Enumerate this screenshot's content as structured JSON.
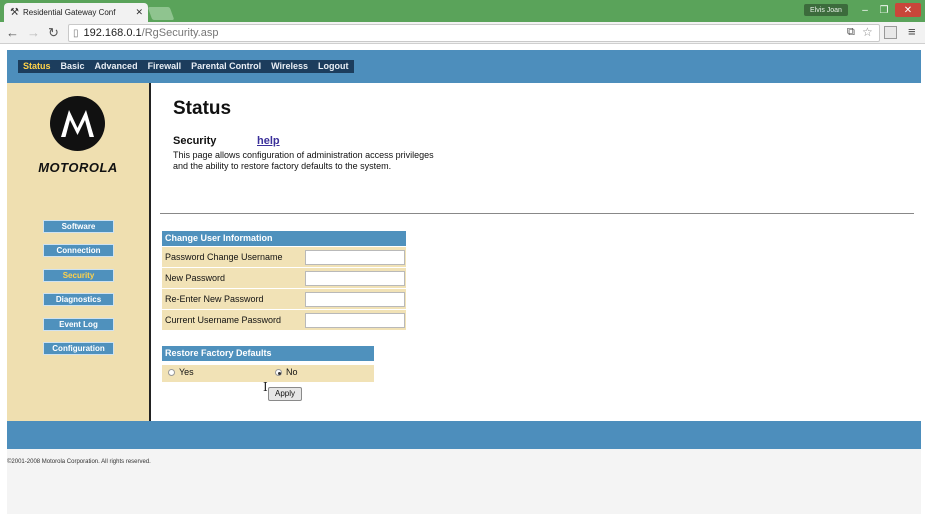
{
  "browser": {
    "tab_title": "Residential Gateway Conf",
    "user_badge": "Elvis Joan",
    "url_host": "192.168.0.1",
    "url_path": "/RgSecurity.asp",
    "icons": [
      "back-icon",
      "forward-icon",
      "reload-icon",
      "page-icon",
      "translate-icon",
      "star-icon",
      "extension-icon",
      "menu-icon",
      "close-icon"
    ]
  },
  "top_nav": {
    "items": [
      {
        "label": "Status",
        "active": true
      },
      {
        "label": "Basic",
        "active": false
      },
      {
        "label": "Advanced",
        "active": false
      },
      {
        "label": "Firewall",
        "active": false
      },
      {
        "label": "Parental Control",
        "active": false
      },
      {
        "label": "Wireless",
        "active": false
      },
      {
        "label": "Logout",
        "active": false
      }
    ]
  },
  "brand": {
    "name": "MOTOROLA"
  },
  "sidebar": {
    "items": [
      {
        "label": "Software",
        "active": false
      },
      {
        "label": "Connection",
        "active": false
      },
      {
        "label": "Security",
        "active": true
      },
      {
        "label": "Diagnostics",
        "active": false
      },
      {
        "label": "Event Log",
        "active": false
      },
      {
        "label": "Configuration",
        "active": false
      }
    ]
  },
  "main": {
    "title": "Status",
    "section": "Security",
    "help": "help",
    "description_line1": "This page allows configuration of administration access privileges",
    "description_line2": "and the ability to restore factory defaults to the system."
  },
  "user_info": {
    "heading": "Change User Information",
    "fields": [
      {
        "label": "Password Change Username",
        "value": ""
      },
      {
        "label": "New Password",
        "value": ""
      },
      {
        "label": "Re-Enter New Password",
        "value": ""
      },
      {
        "label": "Current Username Password",
        "value": ""
      }
    ]
  },
  "restore": {
    "heading": "Restore Factory Defaults",
    "yes_label": "Yes",
    "no_label": "No",
    "selected": "No"
  },
  "apply_label": "Apply",
  "footer": {
    "copyright": "©2001-2008 Motorola Corporation. All rights reserved."
  },
  "colors": {
    "accent": "#4d8ebc",
    "nav_dark": "#1c3d5d",
    "active_text": "#ffd24a",
    "sidebar_bg": "#efdfb0",
    "row_bg": "#f1e2b6"
  }
}
